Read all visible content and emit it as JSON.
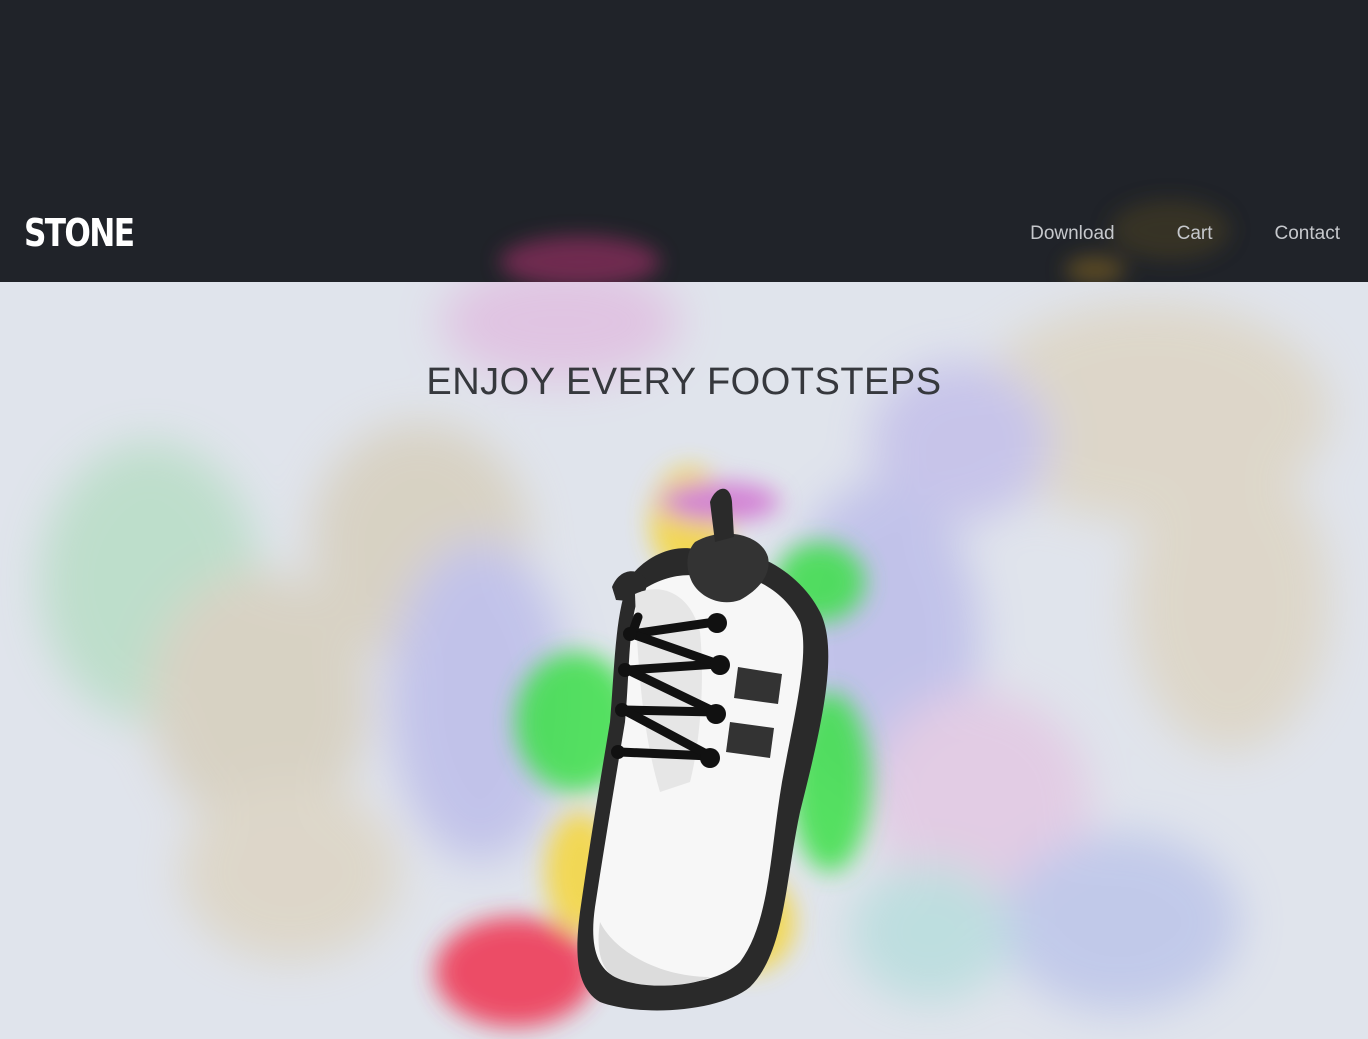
{
  "brand": {
    "logo_text": "STONE"
  },
  "nav": {
    "items": [
      {
        "label": "Download"
      },
      {
        "label": "Cart"
      },
      {
        "label": "Contact"
      }
    ]
  },
  "hero": {
    "title": "ENJOY EVERY FOOTSTEPS",
    "image_subject": "sneaker-with-color-smoke"
  },
  "colors": {
    "header_bg": "#202329",
    "hero_bg": "#e0e4ec",
    "logo": "#ffffff",
    "nav_text": "#c6c8cc",
    "title_text": "#36383d"
  }
}
